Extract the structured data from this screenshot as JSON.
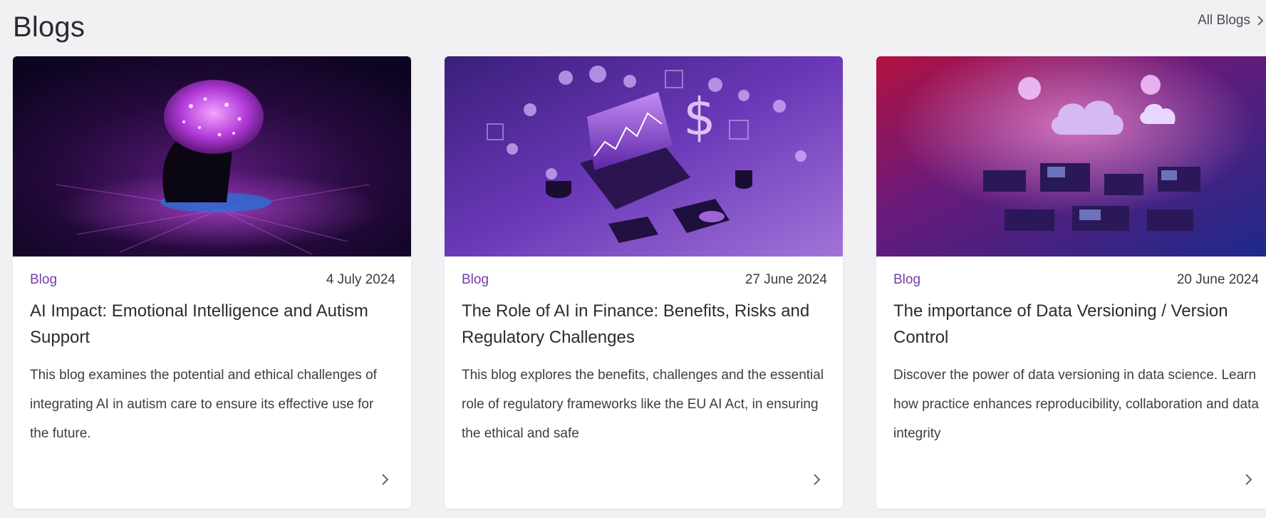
{
  "header": {
    "title": "Blogs",
    "all_link": "All Blogs"
  },
  "cards": [
    {
      "category": "Blog",
      "date": "4 July 2024",
      "title": "AI Impact: Emotional Intelligence and Autism Support",
      "description": "This blog examines the potential and ethical challenges of integrating AI in autism care to ensure its effective use for the future.",
      "image": "brain-head-illustration"
    },
    {
      "category": "Blog",
      "date": "27 June 2024",
      "title": "The Role of AI in Finance: Benefits, Risks and Regulatory Challenges",
      "description": "This blog explores the benefits, challenges and the essential role of regulatory frameworks like the EU AI Act, in ensuring the ethical and safe",
      "image": "finance-laptop-illustration"
    },
    {
      "category": "Blog",
      "date": "20 June 2024",
      "title": "The importance of Data Versioning / Version Control",
      "description": "Discover the power of data versioning in data science. Learn how practice enhances reproducibility, collaboration and data integrity",
      "image": "data-cloud-illustration"
    }
  ],
  "colors": {
    "accent": "#7a3aa8",
    "background": "#f1f1f4",
    "card": "#ffffff"
  }
}
